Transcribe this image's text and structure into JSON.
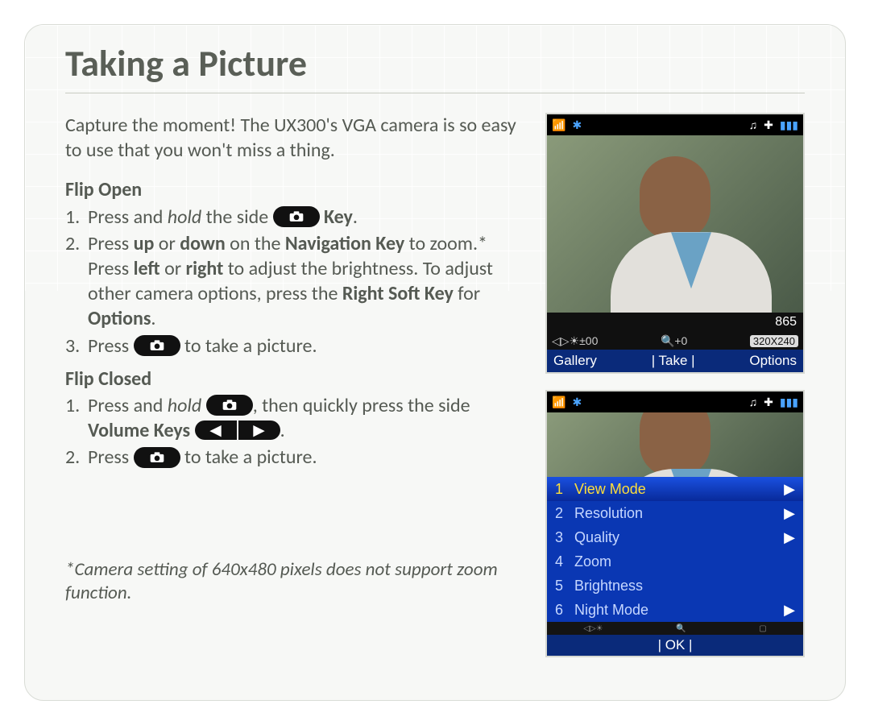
{
  "title": "Taking a Picture",
  "intro": "Capture the moment! The UX300's VGA camera is so easy to use that you won't miss a thing.",
  "flip_open": {
    "heading": "Flip Open",
    "step1_a": "Press and ",
    "step1_b": "hold",
    "step1_c": " the side ",
    "step1_d": " Key",
    "step1_e": ".",
    "step2": "Press ",
    "step2_up": "up",
    "step2_mid": " or ",
    "step2_down": "down",
    "step2_b": " on the ",
    "step2_nav": "Navigation Key",
    "step2_c": " to zoom.* Press ",
    "step2_left": "left",
    "step2_or": " or ",
    "step2_right": "right",
    "step2_d": " to adjust the brightness. To adjust other camera options, press the ",
    "step2_rsk": "Right Soft Key",
    "step2_e": " for ",
    "step2_opt": "Options",
    "step2_f": ".",
    "step3_a": "Press ",
    "step3_b": " to take a picture."
  },
  "flip_closed": {
    "heading": "Flip Closed",
    "step1_a": "Press and ",
    "step1_b": "hold",
    "step1_c": " ",
    "step1_d": ", then quickly press the side ",
    "step1_vol": "Volume Keys",
    "step1_e": " ",
    "step1_f": ".",
    "step2_a": "Press ",
    "step2_b": " to take a picture."
  },
  "footnote": "*Camera setting of 640x480 pixels does not support zoom function.",
  "phone1": {
    "counter": "865",
    "brightness": "±00",
    "zoom": "+0",
    "resolution": "320X240",
    "soft_left": "Gallery",
    "soft_center": "| Take |",
    "soft_right": "Options"
  },
  "phone2": {
    "menu": [
      {
        "n": "1",
        "label": "View Mode",
        "arrow": true,
        "sel": true
      },
      {
        "n": "2",
        "label": "Resolution",
        "arrow": true,
        "sel": false
      },
      {
        "n": "3",
        "label": "Quality",
        "arrow": true,
        "sel": false
      },
      {
        "n": "4",
        "label": "Zoom",
        "arrow": false,
        "sel": false
      },
      {
        "n": "5",
        "label": "Brightness",
        "arrow": false,
        "sel": false
      },
      {
        "n": "6",
        "label": "Night Mode",
        "arrow": true,
        "sel": false
      }
    ],
    "ok": "| OK |"
  }
}
